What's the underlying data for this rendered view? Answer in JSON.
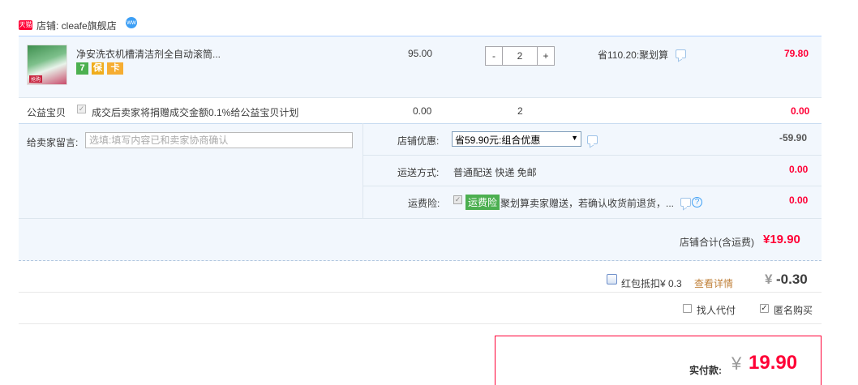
{
  "shop": {
    "logo_text": "天猫",
    "label": "店铺: cleafe旗舰店",
    "ww_icon_text": "ww"
  },
  "item": {
    "thumb_caption": "抢购",
    "title": "净安洗衣机槽清洁剂全自动滚筒...",
    "badges": [
      "7",
      "保",
      "卡"
    ],
    "price": "95.00",
    "qty_minus": "-",
    "qty_value": "2",
    "qty_plus": "+",
    "save_text": "省110.20:聚划算",
    "subtotal": "79.80"
  },
  "charity": {
    "label": "公益宝贝",
    "check_mark": "✓",
    "desc": "成交后卖家将捐赠成交金额0.1%给公益宝贝计划",
    "price": "0.00",
    "qty": "2",
    "amount": "0.00"
  },
  "service": {
    "message_label": "给卖家留言:",
    "message_placeholder": "选填:填写内容已和卖家协商确认",
    "promo_label": "店铺优惠:",
    "promo_value": "省59.90元:组合优惠",
    "promo_arrow": "▼",
    "promo_amount": "-59.90",
    "shipping_label": "运送方式:",
    "shipping_value": "普通配送 快递 免邮",
    "shipping_amount": "0.00",
    "insurance_label": "运费险:",
    "insurance_check": "✓",
    "insurance_badge": "运费险",
    "insurance_text": "聚划算卖家赠送，若确认收货前退货，...",
    "insurance_amount": "0.00",
    "help_glyph": "?"
  },
  "shop_total": {
    "label": "店铺合计(含运费)",
    "amount": "¥19.90"
  },
  "red_packet": {
    "label": "红包抵扣¥ 0.3",
    "details_link": "查看详情",
    "currency": "¥",
    "amount": "-0.30"
  },
  "options": {
    "proxy_label": "找人代付",
    "anon_label": "匿名购买",
    "anon_check": "✓"
  },
  "payment": {
    "label": "实付款:",
    "currency": "¥",
    "amount": "19.90"
  },
  "colors": {
    "accent_red": "#ff0036",
    "row_blue": "#f2f7fd",
    "border_blue": "#b2d1ff",
    "link_orange": "#c0803a",
    "insurance_green": "#4caf50"
  }
}
